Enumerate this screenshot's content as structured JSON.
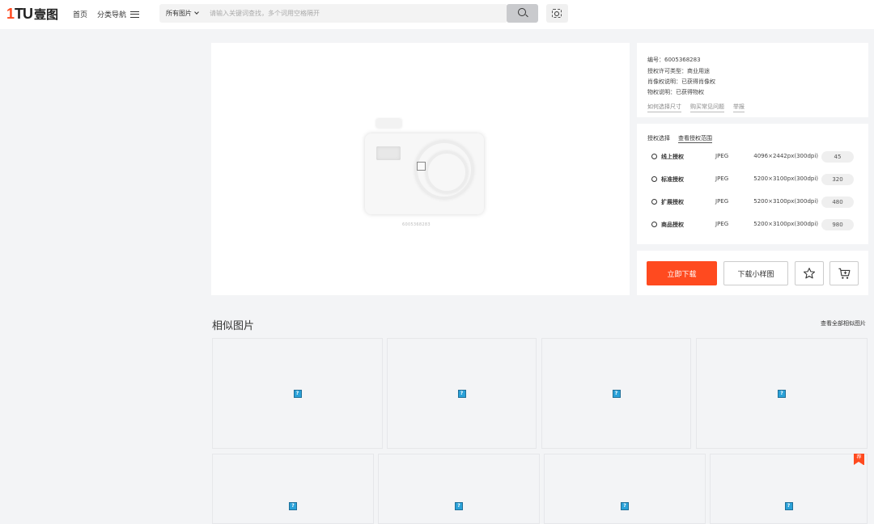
{
  "header": {
    "logo_mark": "1TU",
    "logo_text": "壹图",
    "nav_home": "首页",
    "nav_category": "分类导航",
    "search_scope": "所有图片",
    "search_placeholder": "请输入关键词查找，多个词用空格隔开"
  },
  "preview": {
    "caption": "6005368283"
  },
  "info": {
    "id_label": "编号：6005368283",
    "license_type": "授权许可类型：商业用途",
    "portrait_rights": "肖像权说明：已获得肖像权",
    "property_rights": "物权说明：已获得物权",
    "links": [
      "如何选择尺寸",
      "购买常见问题",
      "举报"
    ]
  },
  "license": {
    "title": "授权选择",
    "scope_link": "查看授权范围",
    "options": [
      {
        "name": "线上授权",
        "format": "JPEG",
        "size": "4096×2442px(300dpi)",
        "price": "45"
      },
      {
        "name": "标准授权",
        "format": "JPEG",
        "size": "5200×3100px(300dpi)",
        "price": "320"
      },
      {
        "name": "扩展授权",
        "format": "JPEG",
        "size": "5200×3100px(300dpi)",
        "price": "480"
      },
      {
        "name": "商品授权",
        "format": "JPEG",
        "size": "5200×3100px(300dpi)",
        "price": "980"
      }
    ]
  },
  "actions": {
    "download_now": "立即下载",
    "download_sample": "下载小样图"
  },
  "similar": {
    "title": "相似图片",
    "view_all": "查看全部相似图片",
    "badge": "荐",
    "placeholder_glyph": "?"
  },
  "colors": {
    "accent": "#ff4a1f",
    "page_bg": "#f3f4f6"
  }
}
